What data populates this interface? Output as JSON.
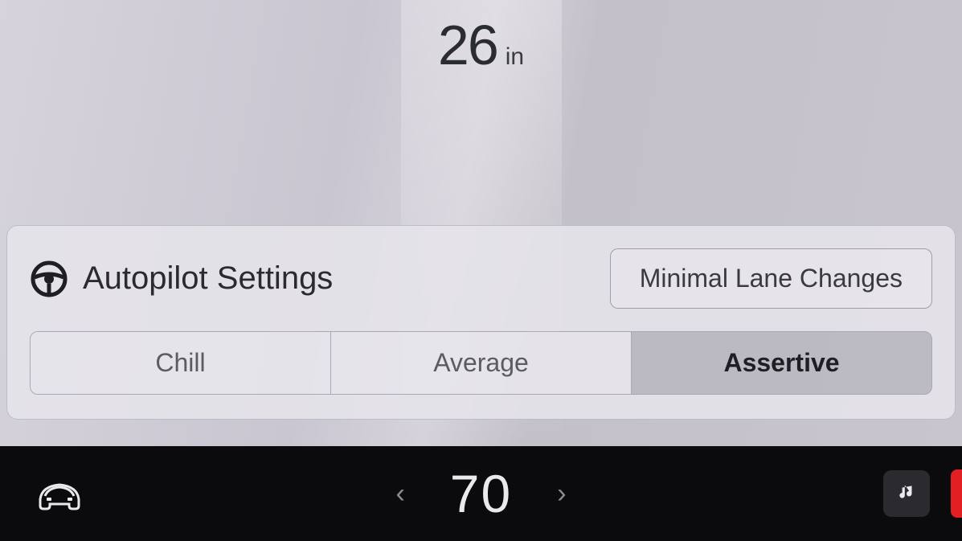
{
  "camera": {
    "distance_value": "26",
    "distance_unit": "in"
  },
  "panel": {
    "title": "Autopilot Settings",
    "minimal_lane_changes_label": "Minimal Lane Changes",
    "modes": {
      "chill": "Chill",
      "average": "Average",
      "assertive": "Assertive",
      "selected": "assertive"
    }
  },
  "dock": {
    "speed": "70"
  }
}
